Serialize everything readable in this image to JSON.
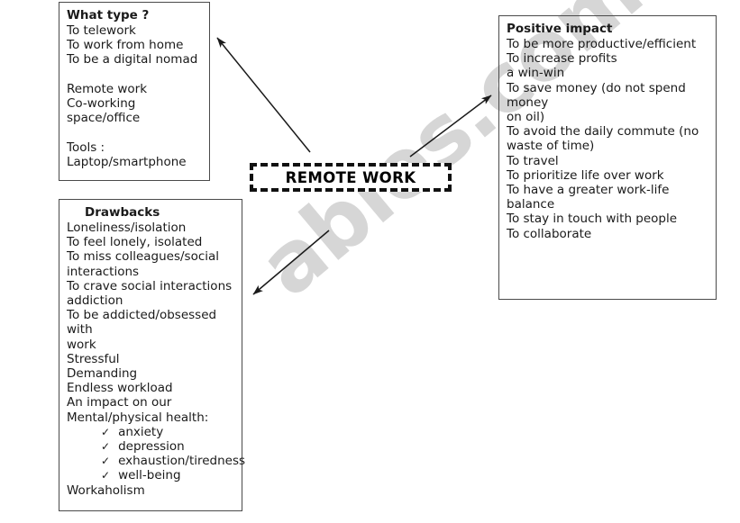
{
  "page": {
    "watermark": "ables.com",
    "background_color": "#ffffff",
    "text_color": "#1a1a1a",
    "watermark_color": "#d6d6d6"
  },
  "center_node": {
    "label": "REMOTE WORK",
    "border_style": "thick dashed",
    "border_color": "#111111"
  },
  "boxes": {
    "what_type": {
      "title": "What type ?",
      "lines": [
        "To telework",
        "To work from home",
        "To be a digital nomad",
        "",
        "Remote work",
        "Co-working space/office",
        "",
        "Tools :",
        "Laptop/smartphone"
      ]
    },
    "drawbacks": {
      "title": "Drawbacks",
      "lines": [
        "Loneliness/isolation",
        "To feel lonely, isolated",
        "To miss colleagues/social",
        "interactions",
        "To crave social interactions",
        "addiction",
        "To be addicted/obsessed with",
        "work",
        "Stressful",
        "Demanding",
        "Endless workload",
        "An impact on our",
        "Mental/physical health:"
      ],
      "checked_items": [
        "anxiety",
        "depression",
        "exhaustion/tiredness",
        "well-being"
      ],
      "trailing_lines": [
        "Workaholism"
      ],
      "check_glyph": "✓"
    },
    "positive_impact": {
      "title": "Positive impact",
      "lines": [
        "To be more productive/efficient",
        "To increase profits",
        "a win-win",
        "To save money (do not spend money",
        "on oil)",
        "To avoid the daily commute (no",
        "waste of time)",
        "To travel",
        "To prioritize life over work",
        "To have a greater work-life balance",
        "To stay in touch with people",
        "To collaborate"
      ]
    }
  },
  "arrows": [
    {
      "name": "arrow-to-what-type",
      "from": "center-node",
      "to": "what-type-box"
    },
    {
      "name": "arrow-to-positive-impact",
      "from": "center-node",
      "to": "positive-impact-box"
    },
    {
      "name": "arrow-to-drawbacks",
      "from": "center-node",
      "to": "drawbacks-box"
    }
  ]
}
